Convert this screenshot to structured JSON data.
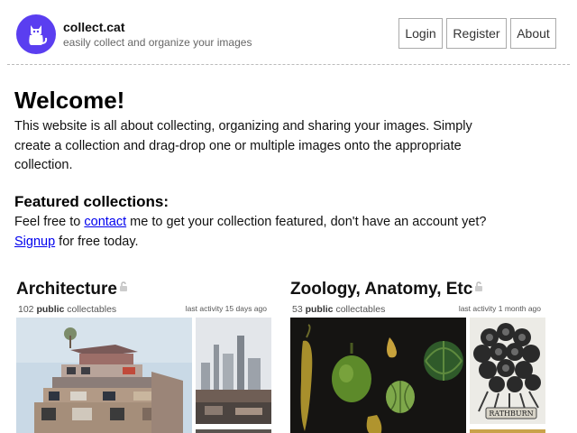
{
  "brand": {
    "name": "collect.cat",
    "tagline": "easily collect and organize your images",
    "logo_icon": "cat-icon",
    "logo_color": "#5a3ef0"
  },
  "nav": {
    "login": "Login",
    "register": "Register",
    "about": "About"
  },
  "welcome": {
    "title": "Welcome!",
    "body": "This website is all about collecting, organizing and sharing your images.  Simply create a collection and drag-drop one or multiple images onto the appropriate collection."
  },
  "featured": {
    "title": "Featured collections:",
    "text_before_contact": "Feel free to ",
    "contact_link": "contact",
    "text_after_contact": " me to get your collection featured, don't have an account yet?",
    "signup_link": "Signup",
    "text_after_signup": " for free today."
  },
  "collections": [
    {
      "title": "Architecture",
      "count": "102",
      "visibility": "public",
      "suffix": "collectables",
      "activity": "last activity 15 days ago"
    },
    {
      "title": "Zoology, Anatomy, Etc",
      "count": "53",
      "visibility": "public",
      "suffix": "collectables",
      "activity": "last activity 1 month ago"
    }
  ],
  "colors": {
    "link": "#0000ee",
    "button_border": "#aaaaaa"
  }
}
